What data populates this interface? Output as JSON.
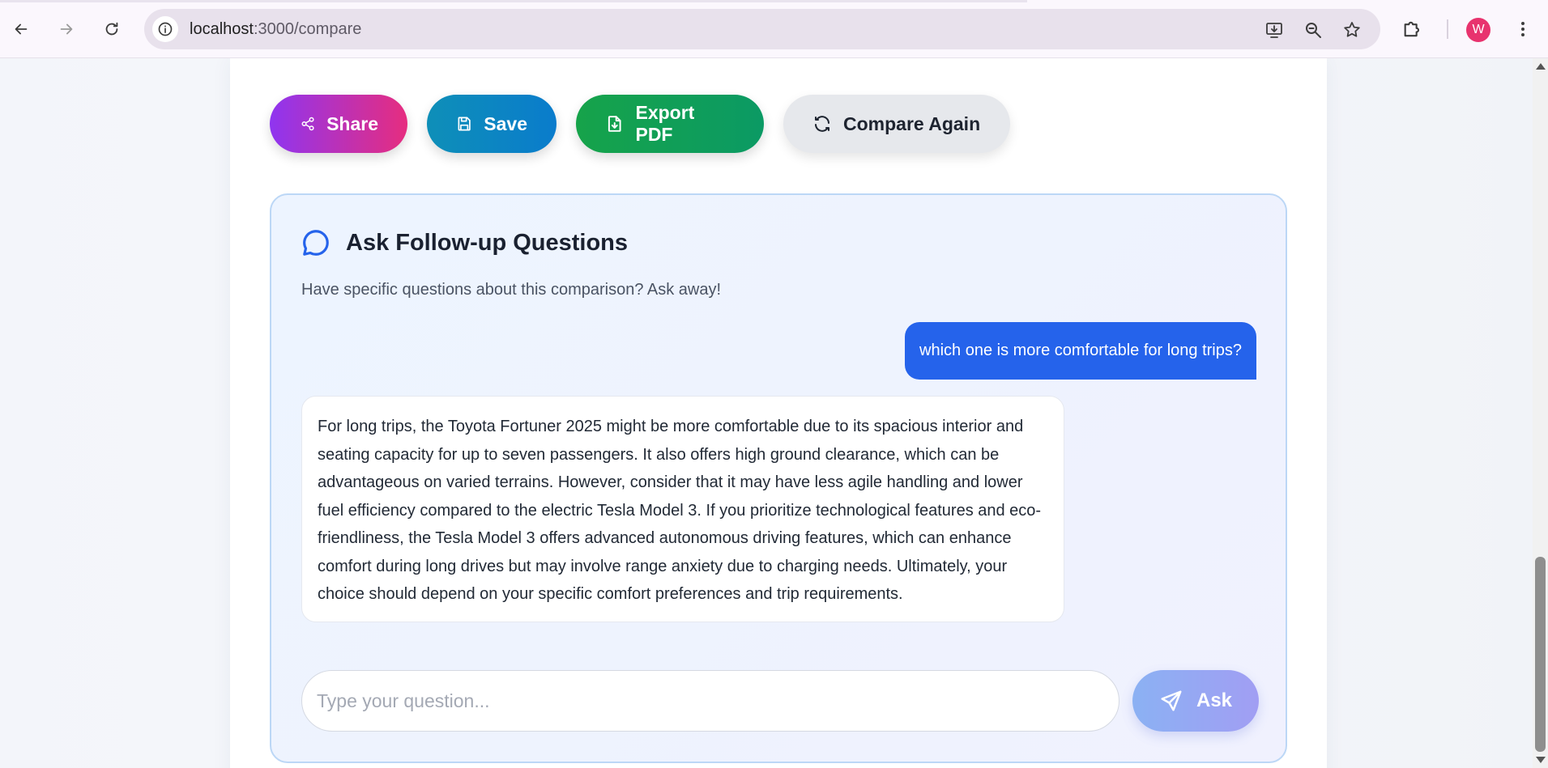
{
  "browser": {
    "url_host": "localhost",
    "url_path": ":3000/compare",
    "profile_initial": "W"
  },
  "actions": {
    "share_label": "Share",
    "save_label": "Save",
    "export_label": "Export PDF",
    "compare_label": "Compare Again"
  },
  "qa": {
    "title": "Ask Follow-up Questions",
    "subtitle": "Have specific questions about this comparison? Ask away!",
    "messages": [
      {
        "role": "user",
        "text": "which one is more comfortable for long trips?"
      },
      {
        "role": "assistant",
        "text": "For long trips, the Toyota Fortuner 2025 might be more comfortable due to its spacious interior and seating capacity for up to seven passengers. It also offers high ground clearance, which can be advantageous on varied terrains. However, consider that it may have less agile handling and lower fuel efficiency compared to the electric Tesla Model 3. If you prioritize technological features and eco-friendliness, the Tesla Model 3 offers advanced autonomous driving features, which can enhance comfort during long drives but may involve range anxiety due to charging needs. Ultimately, your choice should depend on your specific comfort preferences and trip requirements."
      }
    ],
    "input_placeholder": "Type your question...",
    "input_value": "",
    "ask_label": "Ask"
  },
  "colors": {
    "user_bubble": "#2563eb",
    "accent_blue": "#2563eb",
    "share_gradient": [
      "#8f35f0",
      "#e62d7f"
    ],
    "save_gradient": [
      "#0e8fb8",
      "#0a7ccc"
    ],
    "export_gradient": [
      "#16a34a",
      "#0b9a64"
    ],
    "avatar": "#e8336e"
  },
  "icons": {
    "back": "arrow-left-icon",
    "forward": "arrow-right-icon",
    "reload": "reload-icon",
    "site_info": "info-icon",
    "install": "install-app-icon",
    "zoom": "zoom-icon",
    "bookmark": "star-icon",
    "extensions": "puzzle-icon",
    "menu": "kebab-menu-icon",
    "share": "share-icon",
    "save": "floppy-disk-icon",
    "export": "file-download-icon",
    "compare": "refresh-icon",
    "chat": "chat-bubble-icon",
    "send": "send-icon"
  }
}
